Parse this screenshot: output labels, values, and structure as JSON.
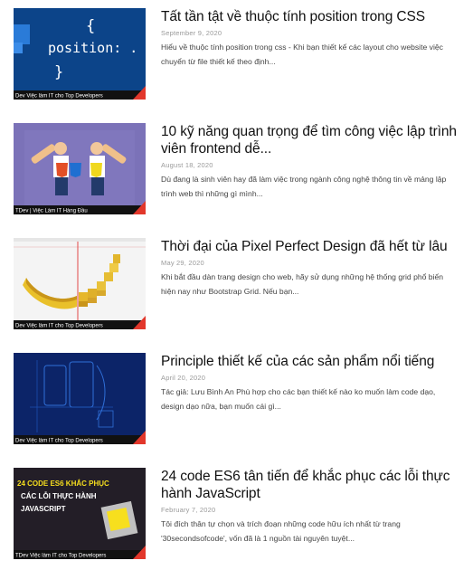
{
  "posts": [
    {
      "title": "Tất tần tật về thuộc tính position trong CSS",
      "date": "September 9, 2020",
      "excerpt": "Hiểu về thuộc tính position trong css - Khi bạn thiết kế các layout cho website việc chuyển từ file thiết kế theo định...",
      "thumb_text": [
        "{",
        "position: .",
        "}"
      ],
      "thumb_caption": "Dev  Việc làm IT cho Top Developers"
    },
    {
      "title": "10 kỹ năng quan trọng để tìm công việc lập trình viên frontend dễ...",
      "date": "August 18, 2020",
      "excerpt": "Dù đang là sinh viên hay đã làm việc trong ngành công nghệ thông tin về mảng lập trình web thì những gì mình...",
      "thumb_caption": "TDev | Việc Làm IT Hàng Đầu"
    },
    {
      "title": "Thời đại của Pixel Perfect Design đã hết từ lâu",
      "date": "May 29, 2020",
      "excerpt": "Khi bắt đầu dàn trang design cho web, hãy sử dụng những hệ thống grid phổ biến hiện nay như Bootstrap Grid. Nếu bạn...",
      "thumb_caption": "Dev  Việc làm IT cho Top Developers"
    },
    {
      "title": "Principle thiết kế của các sản phẩm nổi tiếng",
      "date": "April 20, 2020",
      "excerpt": "Tác giả: Lưu Bình An Phù hợp cho các bạn thiết kế nào ko muốn làm code dạo, design dạo nữa, bạn muốn cái gì...",
      "thumb_caption": "Dev  Việc làm IT cho Top Developers"
    },
    {
      "title": "24 code ES6 tân tiến để khắc phục các lỗi thực hành JavaScript",
      "date": "February 7, 2020",
      "excerpt": "Tôi đích thân tự chọn và trích đoạn những code hữu ích nhất từ trang '30secondsofcode', vốn đã là 1 nguồn tài nguyên tuyệt...",
      "thumb_text": [
        "24 CODE ES6 KHẮC PHỤC",
        "CÁC LỖI THỰC HÀNH",
        "JAVASCRIPT"
      ],
      "thumb_caption": "TDev  Việc làm IT cho Top Developers"
    }
  ],
  "colors": {
    "corner_red": "#e2372b",
    "caption_bg": "#111111",
    "date": "#9a9a9a",
    "title": "#111111"
  }
}
